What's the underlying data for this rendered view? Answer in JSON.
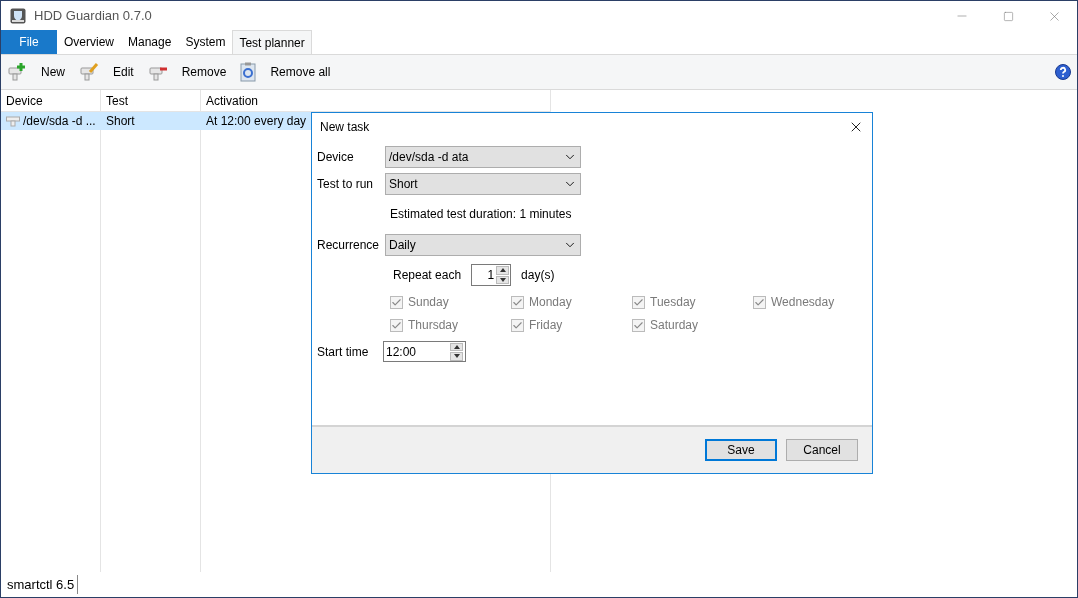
{
  "window": {
    "title": "HDD Guardian 0.7.0"
  },
  "file_menu": "File",
  "tabs": [
    {
      "label": "Overview",
      "selected": false,
      "kind": "tab"
    },
    {
      "label": "Manage",
      "selected": false,
      "kind": "tab"
    },
    {
      "label": "System",
      "selected": false,
      "kind": "tab"
    },
    {
      "label": "Test planner",
      "selected": true,
      "kind": "tab"
    }
  ],
  "toolbar": [
    {
      "label": "New",
      "kind": "add"
    },
    {
      "label": "Edit",
      "kind": "edit"
    },
    {
      "label": "Remove",
      "kind": "remove"
    },
    {
      "label": "Remove all",
      "kind": "clear"
    }
  ],
  "table": {
    "columns": [
      "Device",
      "Test",
      "Activation"
    ],
    "rows": [
      {
        "cells": [
          "/dev/sda -d ...",
          "Short",
          "At 12:00 every day"
        ],
        "selected": true
      }
    ]
  },
  "dialog": {
    "title": "New task",
    "device": {
      "label": "Device",
      "value": "/dev/sda -d ata"
    },
    "test": {
      "label": "Test to run",
      "value": "Short"
    },
    "estimate": "Estimated test duration: 1 minutes",
    "recurrence": {
      "label": "Recurrence",
      "value": "Daily"
    },
    "repeat": {
      "label": "Repeat each",
      "value": "1",
      "unit": "day(s)"
    },
    "days": [
      {
        "label": "Sunday",
        "checked": true,
        "disabled": true
      },
      {
        "label": "Monday",
        "checked": true,
        "disabled": true
      },
      {
        "label": "Tuesday",
        "checked": true,
        "disabled": true
      },
      {
        "label": "Wednesday",
        "checked": true,
        "disabled": true
      },
      {
        "label": "Thursday",
        "checked": true,
        "disabled": true
      },
      {
        "label": "Friday",
        "checked": true,
        "disabled": true
      },
      {
        "label": "Saturday",
        "checked": true,
        "disabled": true
      }
    ],
    "start_time": {
      "label": "Start time",
      "value": "12:00"
    },
    "buttons": [
      {
        "label": "Save",
        "selected": true
      },
      {
        "label": "Cancel",
        "selected": false
      }
    ]
  },
  "status_bar": "smartctl 6.5"
}
